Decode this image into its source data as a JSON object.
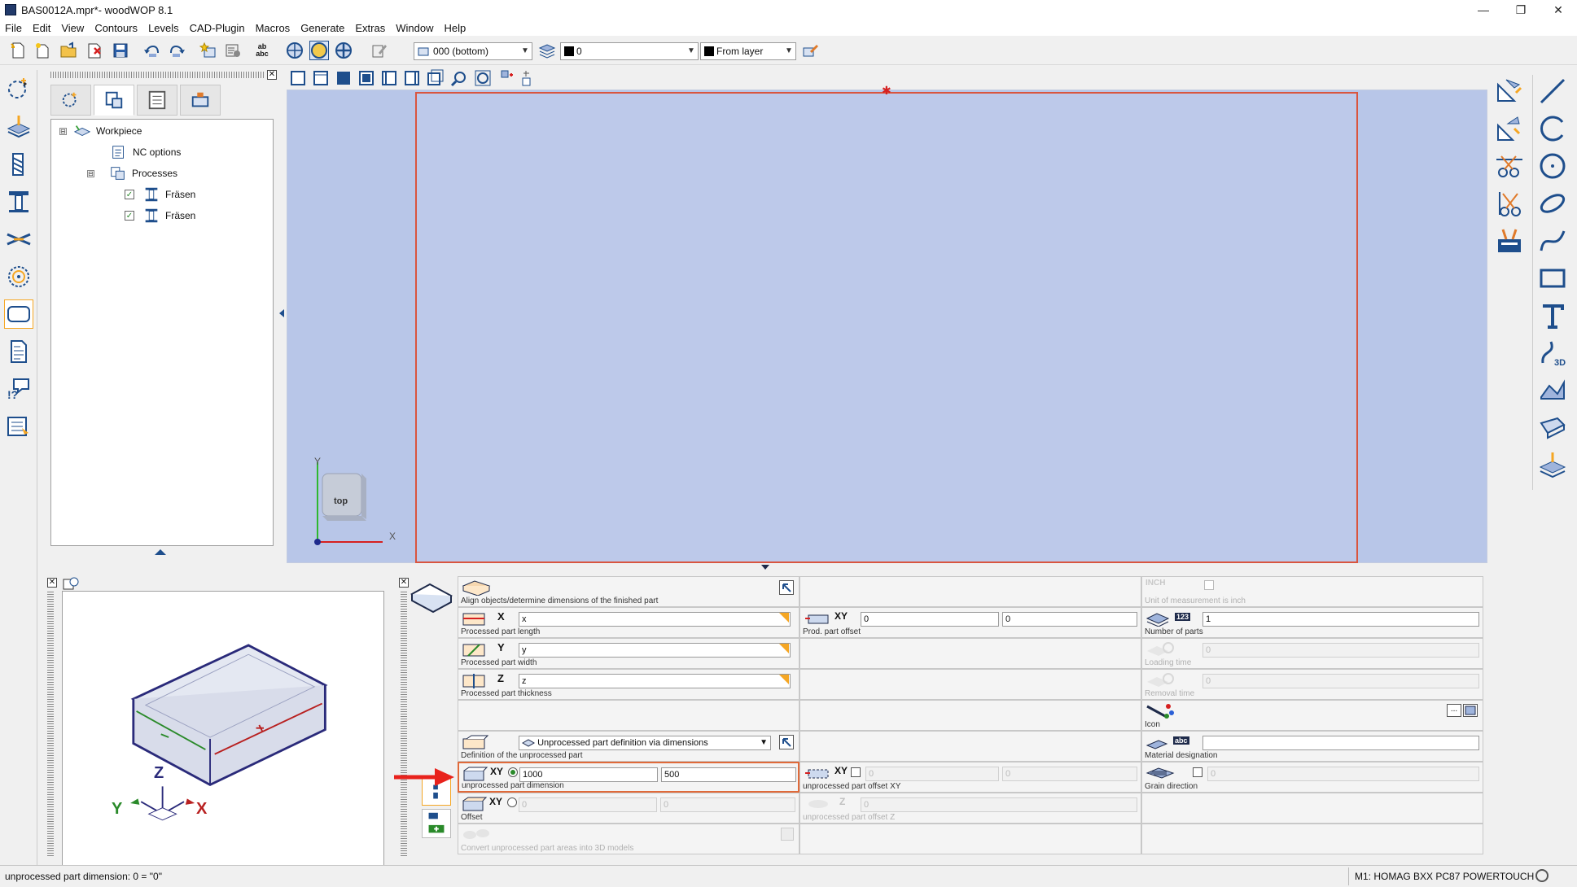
{
  "window": {
    "title": "BAS0012A.mpr*- woodWOP 8.1",
    "minimize_glyph": "—",
    "maximize_glyph": "❐",
    "close_glyph": "✕"
  },
  "menu": [
    "File",
    "Edit",
    "View",
    "Contours",
    "Levels",
    "CAD-Plugin",
    "Macros",
    "Generate",
    "Extras",
    "Window",
    "Help"
  ],
  "toolbar": {
    "plane_select": "000  (bottom)",
    "layer_select": "0",
    "color_select": "From layer",
    "ab_label": "ab",
    "abc_label": "abc"
  },
  "tree": {
    "collapse_glyph": "⊟",
    "check_glyph": "✓",
    "items": [
      {
        "label": "Workpiece"
      },
      {
        "label": "NC options"
      },
      {
        "label": "Processes"
      },
      {
        "label": "Fräsen"
      },
      {
        "label": "Fräsen"
      }
    ]
  },
  "viewport": {
    "axis_y": "Y",
    "axis_x": "X",
    "cube_label": "top",
    "origin_marker": "✱"
  },
  "preview": {
    "axis_x": "X",
    "axis_y": "Y",
    "axis_z": "Z"
  },
  "props": {
    "close_glyph": "✕",
    "align_label": "Align objects/determine dimensions of the finished part",
    "x_axis": "X",
    "x_value": "x",
    "x_label": "Processed part length",
    "y_axis": "Y",
    "y_value": "y",
    "y_label": "Processed part width",
    "z_axis": "Z",
    "z_value": "z",
    "z_label": "Processed part thickness",
    "offset_axis": "XY",
    "offset_x": "0",
    "offset_y": "0",
    "offset_label": "Prod. part offset",
    "inch_tag": "INCH",
    "inch_label": "Unit of measurement is inch",
    "parts_tag": "123",
    "parts_value": "1",
    "parts_label": "Number of parts",
    "loading_value": "0",
    "loading_label": "Loading time",
    "removal_value": "0",
    "removal_label": "Removal time",
    "icon_label": "Icon",
    "icon_more": "...",
    "def_select": "Unprocessed part definition via dimensions",
    "def_label": "Definition of the unprocessed part",
    "abc_tag": "abc",
    "material_value": "",
    "material_label": "Material designation",
    "dim_axis": "XY",
    "dim_x": "1000",
    "dim_y": "500",
    "dim_label": "unprocessed part dimension",
    "uoff_axis": "XY",
    "uoff_x": "0",
    "uoff_y": "0",
    "uoff_label": "unprocessed part offset XY",
    "grain_value": "0",
    "grain_label": "Grain direction",
    "offset2_axis": "XY",
    "offset2_x": "0",
    "offset2_y": "0",
    "offset2_label": "Offset",
    "uoffz_axis": "Z",
    "uoffz_value": "0",
    "uoffz_label": "unprocessed part offset Z",
    "convert_label": "Convert unprocessed part areas into 3D models"
  },
  "status": {
    "left": "unprocessed part dimension: 0 = \"0\"",
    "right": "M1: HOMAG BXX PC87 POWERTOUCH"
  },
  "colors": {
    "viewport_bg": "#b8c6e8",
    "workpiece_border": "#d9553f",
    "icon_blue": "#1e4e8c",
    "accent_orange": "#f5a623",
    "annotation_red": "#e8221c"
  }
}
